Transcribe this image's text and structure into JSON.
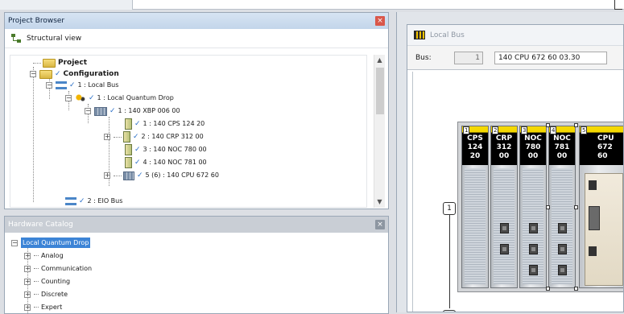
{
  "project_browser": {
    "title": "Project Browser",
    "close_symbol": "×",
    "view_label": "Structural view",
    "tree": {
      "project": "Project",
      "configuration": "Configuration",
      "local_bus": "1 : Local Bus",
      "local_drop": "1 : Local Quantum Drop",
      "rack": "1 : 140 XBP 006 00",
      "modules": [
        "1 : 140 CPS 124 20",
        "2 : 140 CRP 312 00",
        "3 : 140 NOC 780 00",
        "4 : 140 NOC 781 00",
        "5 (6) : 140 CPU 672 60"
      ],
      "eio_bus": "2 : EIO Bus"
    }
  },
  "hardware_catalog": {
    "title": "Hardware Catalog",
    "close_symbol": "×",
    "root": "Local Quantum Drop",
    "items": [
      "Analog",
      "Communication",
      "Counting",
      "Discrete",
      "Expert"
    ]
  },
  "local_bus": {
    "title": "Local Bus",
    "bus_label": "Bus:",
    "bus_number": "1",
    "cpu_field": "140 CPU 672 60   03.30",
    "rack_marker_top": "1",
    "modules": [
      {
        "slot": "1",
        "l1": "CPS",
        "l2": "124",
        "l3": "20"
      },
      {
        "slot": "2",
        "l1": "CRP",
        "l2": "312",
        "l3": "00"
      },
      {
        "slot": "3",
        "l1": "NOC",
        "l2": "780",
        "l3": "00"
      },
      {
        "slot": "4",
        "l1": "NOC",
        "l2": "781",
        "l3": "00"
      }
    ],
    "cpu": {
      "slot": "5",
      "l1": "CPU",
      "l2": "672",
      "l3": "60"
    }
  },
  "colors": {
    "selection": "#3c84d6",
    "module_top": "#f4d800",
    "close_red": "#d9574a"
  },
  "icons": {
    "structural_view": "tree-structure-icon",
    "project": "folder-icon",
    "bus": "bus-icon",
    "drop": "drop-icon",
    "rack": "rack-icon",
    "module": "module-icon"
  }
}
